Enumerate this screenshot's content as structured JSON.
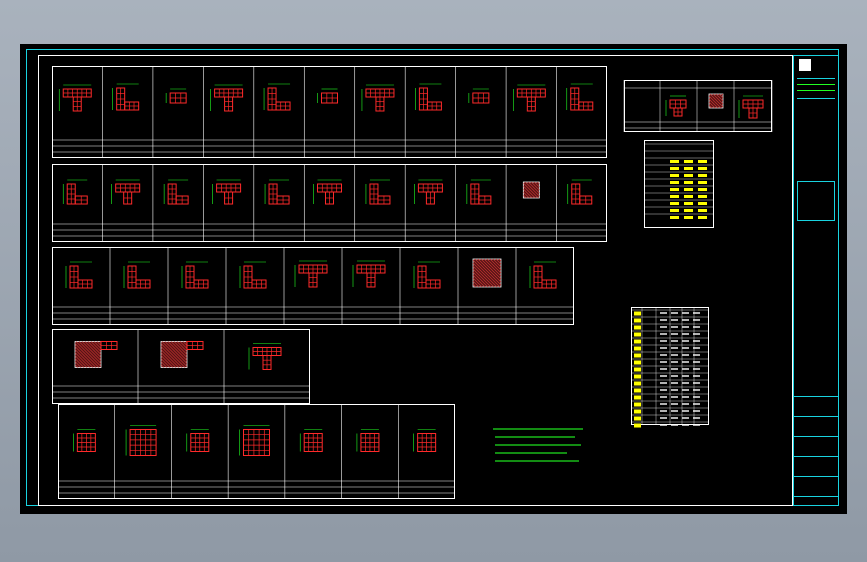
{
  "drawing": {
    "title": "",
    "sheet": ""
  },
  "title_block": {
    "logo": "logo-box",
    "rows": [
      "",
      "",
      "",
      "",
      "",
      "",
      "",
      ""
    ]
  },
  "panels": [
    {
      "id": "row1",
      "cols": 11
    },
    {
      "id": "row2",
      "cols": 11
    },
    {
      "id": "row3",
      "cols": 9
    },
    {
      "id": "row4",
      "cols": 3
    },
    {
      "id": "row5",
      "cols": 7
    }
  ],
  "notes": [
    "",
    "",
    "",
    "",
    ""
  ],
  "colors": {
    "frame": "#19d3e0",
    "rebar": "#ff2a2a",
    "dim": "#22ff22",
    "text": "#ffffff",
    "highlight": "#ffff00",
    "hatch": "#cc3333"
  }
}
